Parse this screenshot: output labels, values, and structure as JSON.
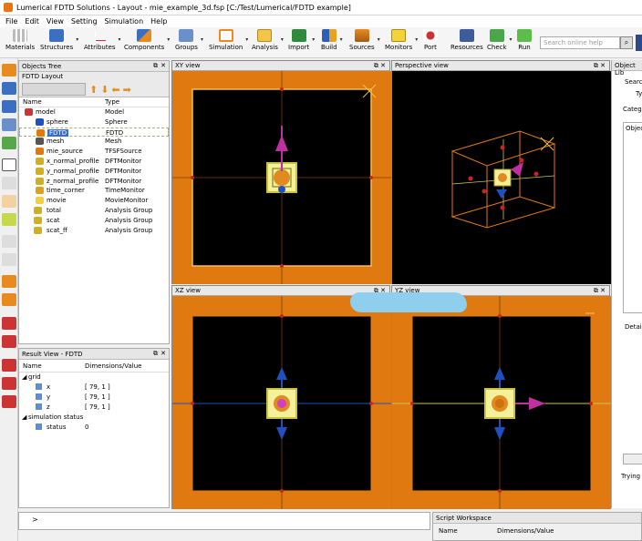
{
  "window": {
    "title": "Lumerical FDTD Solutions - Layout - mie_example_3d.fsp [C:/Test/Lumerical/FDTD example]"
  },
  "menu": [
    "File",
    "Edit",
    "View",
    "Setting",
    "Simulation",
    "Help"
  ],
  "toolbar": [
    {
      "label": "Materials",
      "icon": "grid-icon"
    },
    {
      "label": "Structures",
      "icon": "cube-icon"
    },
    {
      "label": "Attributes",
      "icon": "axis-icon"
    },
    {
      "label": "Components",
      "icon": "shapes-icon"
    },
    {
      "label": "Groups",
      "icon": "folders-icon"
    },
    {
      "label": "Simulation",
      "icon": "region-icon"
    },
    {
      "label": "Analysis",
      "icon": "plot-icon"
    },
    {
      "label": "Import",
      "icon": "gds-icon"
    },
    {
      "label": "Build",
      "icon": "build-icon"
    },
    {
      "label": "Sources",
      "icon": "source-icon"
    },
    {
      "label": "Monitors",
      "icon": "monitor-icon"
    },
    {
      "label": "Port",
      "icon": "port-icon"
    },
    {
      "label": "Resources",
      "icon": "network-icon"
    },
    {
      "label": "Check",
      "icon": "check-icon"
    },
    {
      "label": "Run",
      "icon": "run-icon"
    }
  ],
  "search": {
    "placeholder": "Search online help"
  },
  "objects_tree": {
    "title": "Objects Tree",
    "layout_label": "FDTD Layout",
    "columns": [
      "Name",
      "Type"
    ],
    "rows": [
      {
        "name": "model",
        "type": "Model"
      },
      {
        "name": "sphere",
        "type": "Sphere"
      },
      {
        "name": "FDTD",
        "type": "FDTD"
      },
      {
        "name": "mesh",
        "type": "Mesh"
      },
      {
        "name": "mie_source",
        "type": "TFSFSource"
      },
      {
        "name": "x_normal_profile",
        "type": "DFTMonitor"
      },
      {
        "name": "y_normal_profile",
        "type": "DFTMonitor"
      },
      {
        "name": "z_normal_profile",
        "type": "DFTMonitor"
      },
      {
        "name": "time_corner",
        "type": "TimeMonitor"
      },
      {
        "name": "movie",
        "type": "MovieMonitor"
      },
      {
        "name": "total",
        "type": "Analysis Group"
      },
      {
        "name": "scat",
        "type": "Analysis Group"
      },
      {
        "name": "scat_ff",
        "type": "Analysis Group"
      }
    ]
  },
  "result_view": {
    "title": "Result View - FDTD",
    "columns": [
      "Name",
      "Dimensions/Value"
    ],
    "rows": [
      {
        "name": "grid",
        "value": ""
      },
      {
        "name": "x",
        "value": "[ 79, 1 ]"
      },
      {
        "name": "y",
        "value": "[ 79, 1 ]"
      },
      {
        "name": "z",
        "value": "[ 79, 1 ]"
      },
      {
        "name": "simulation status",
        "value": ""
      },
      {
        "name": "status",
        "value": "0"
      }
    ]
  },
  "views": {
    "xy": "XY view",
    "persp": "Perspective view",
    "xz": "XZ view",
    "yz": "YZ view"
  },
  "object_library": {
    "title": "Object Lib",
    "search": "Searc",
    "type": "Ty",
    "category": "Categ",
    "objects": "Objec",
    "details": "Detai",
    "status": "Trying"
  },
  "command": {
    "prompt": ">"
  },
  "script_workspace": {
    "title": "Script Workspace",
    "col1": "Name",
    "col2": "Dimensions/Value"
  }
}
